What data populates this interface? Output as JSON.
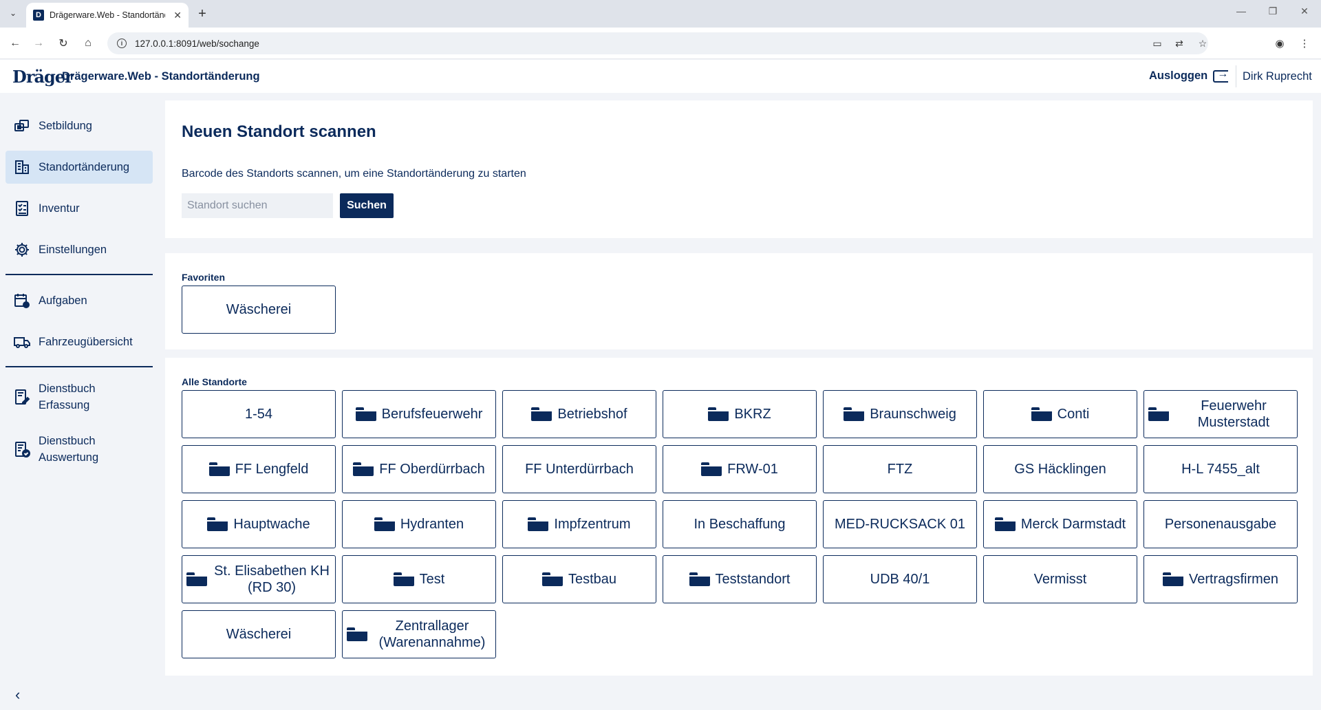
{
  "browser": {
    "tab_title": "Drägerware.Web - Standortänd",
    "tab_favicon": "D",
    "url": "127.0.0.1:8091/web/sochange"
  },
  "header": {
    "logo": "Dräger",
    "title": "Drägerware.Web - Standortänderung",
    "logout_label": "Ausloggen",
    "user": "Dirk Ruprecht"
  },
  "sidebar": {
    "items": [
      {
        "label": "Setbildung",
        "icon": "set-icon"
      },
      {
        "label": "Standortänderung",
        "icon": "building-icon",
        "active": true
      },
      {
        "label": "Inventur",
        "icon": "checklist-icon"
      },
      {
        "label": "Einstellungen",
        "icon": "gear-icon"
      },
      {
        "label": "Aufgaben",
        "icon": "calendar-icon"
      },
      {
        "label": "Fahrzeugübersicht",
        "icon": "truck-icon"
      },
      {
        "label_1": "Dienstbuch",
        "label_2": "Erfassung",
        "icon": "logbook-edit-icon"
      },
      {
        "label_1": "Dienstbuch",
        "label_2": "Auswertung",
        "icon": "logbook-check-icon"
      }
    ]
  },
  "scan": {
    "heading": "Neuen Standort scannen",
    "description": "Barcode des Standorts scannen, um eine Standortänderung zu starten",
    "search_placeholder": "Standort suchen",
    "search_button": "Suchen"
  },
  "favorites": {
    "label": "Favoriten",
    "items": [
      {
        "name": "Wäscherei",
        "folder": false
      }
    ]
  },
  "all_locations": {
    "label": "Alle Standorte",
    "items": [
      {
        "name": "1-54",
        "folder": false
      },
      {
        "name": "Berufsfeuerwehr",
        "folder": true
      },
      {
        "name": "Betriebshof",
        "folder": true
      },
      {
        "name": "BKRZ",
        "folder": true
      },
      {
        "name": "Braunschweig",
        "folder": true
      },
      {
        "name": "Conti",
        "folder": true
      },
      {
        "name": "Feuerwehr Musterstadt",
        "folder": true
      },
      {
        "name": "FF Lengfeld",
        "folder": true
      },
      {
        "name": "FF Oberdürrbach",
        "folder": true
      },
      {
        "name": "FF Unterdürrbach",
        "folder": false
      },
      {
        "name": "FRW-01",
        "folder": true
      },
      {
        "name": "FTZ",
        "folder": false
      },
      {
        "name": "GS Häcklingen",
        "folder": false
      },
      {
        "name": "H-L 7455_alt",
        "folder": false
      },
      {
        "name": "Hauptwache",
        "folder": true
      },
      {
        "name": "Hydranten",
        "folder": true
      },
      {
        "name": "Impfzentrum",
        "folder": true
      },
      {
        "name": "In Beschaffung",
        "folder": false
      },
      {
        "name": "MED-RUCKSACK 01",
        "folder": false
      },
      {
        "name": "Merck Darmstadt",
        "folder": true
      },
      {
        "name": "Personenausgabe",
        "folder": false
      },
      {
        "name": "St. Elisabethen KH (RD 30)",
        "folder": true
      },
      {
        "name": "Test",
        "folder": true
      },
      {
        "name": "Testbau",
        "folder": true
      },
      {
        "name": "Teststandort",
        "folder": true
      },
      {
        "name": "UDB 40/1",
        "folder": false
      },
      {
        "name": "Vermisst",
        "folder": false
      },
      {
        "name": "Vertragsfirmen",
        "folder": true
      },
      {
        "name": "Wäscherei",
        "folder": false
      },
      {
        "name": "Zentrallager (Warenannahme)",
        "folder": true
      }
    ]
  }
}
